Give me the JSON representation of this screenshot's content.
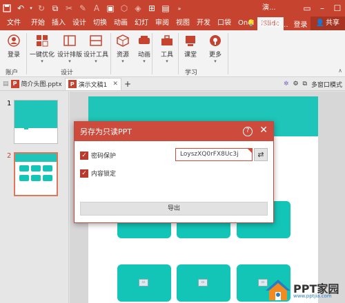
{
  "titlebar": {
    "title": "演..."
  },
  "tabs": {
    "items": [
      "文件",
      "开始",
      "插入",
      "设计",
      "切换",
      "动画",
      "幻灯",
      "审阅",
      "视图",
      "开发",
      "口袋",
      "OneI",
      "iSlide"
    ],
    "active_index": 12,
    "search_placeholder": "告诉我...",
    "login": "登录",
    "share": "共享"
  },
  "ribbon": {
    "buttons": {
      "login": "登录",
      "one_click": "一键优化",
      "design_layout": "设计排版",
      "design_tools": "设计工具",
      "resources": "资源",
      "animation": "动画",
      "tools": "工具",
      "classroom": "课堂",
      "more": "更多"
    },
    "groups": {
      "account": "账户",
      "design": "设计",
      "learn": "学习"
    }
  },
  "doctabs": {
    "tab1": "简介头图.pptx",
    "tab2": "演示文稿1",
    "multi_window": "多窗口模式"
  },
  "thumbnails": {
    "slide1_num": "1",
    "slide2_num": "2"
  },
  "dialog": {
    "title": "另存为只读PPT",
    "password_label": "密码保护",
    "password_value": "LoyszXQ0rFX8Uc3j",
    "content_lock_label": "内容锁定",
    "export_label": "导出"
  },
  "watermark": {
    "brand": "PPT家园",
    "url": "www.pptjia.com"
  },
  "colors": {
    "brand_red": "#c6442f",
    "teal": "#13c5b7"
  }
}
